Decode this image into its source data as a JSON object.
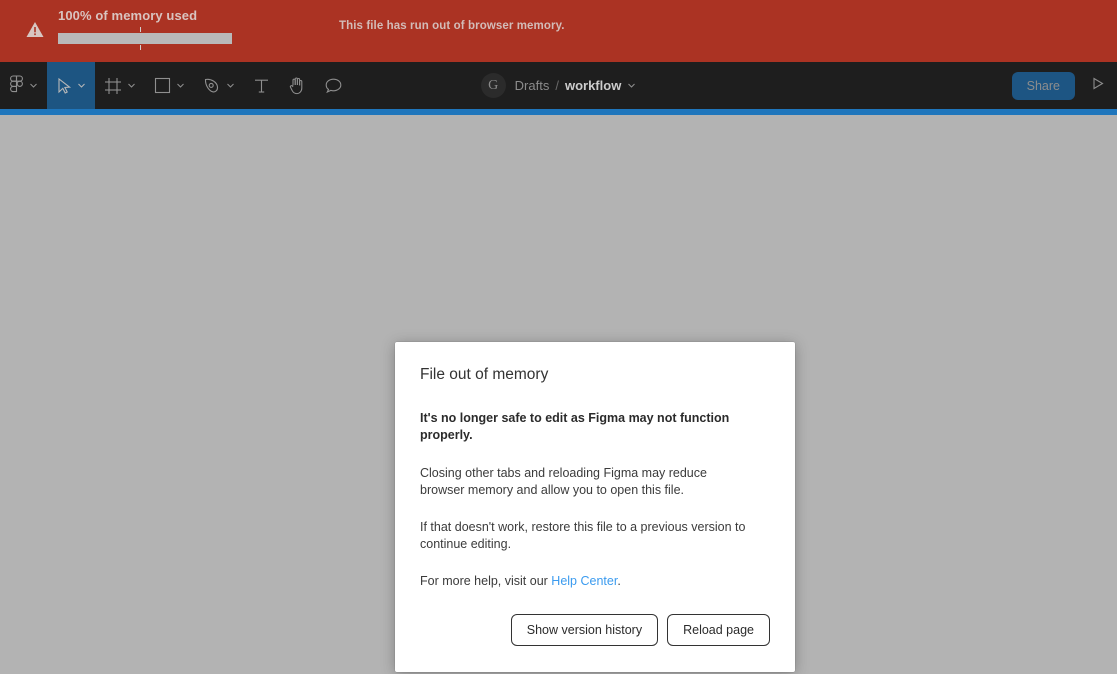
{
  "banner": {
    "warning_icon": "warning-triangle-icon",
    "title": "100% of memory used",
    "message": "This file has run out of browser memory.",
    "progress_percent": 100,
    "progress_marker_percent": 47,
    "background_color": "#ab3323",
    "progress_fill_color": "#b9b9b9"
  },
  "toolbar": {
    "background_color": "#1e1e1e",
    "selected_tool_color": "#1d5582",
    "tools": [
      {
        "name": "figma-menu",
        "icon": "figma-logo-icon",
        "has_chevron": true,
        "selected": false
      },
      {
        "name": "move-tool",
        "icon": "cursor-arrow-icon",
        "has_chevron": true,
        "selected": true
      },
      {
        "name": "frame-tool",
        "icon": "frame-icon",
        "has_chevron": true,
        "selected": false
      },
      {
        "name": "shape-tool",
        "icon": "rectangle-icon",
        "has_chevron": true,
        "selected": false
      },
      {
        "name": "pen-tool",
        "icon": "pen-icon",
        "has_chevron": true,
        "selected": false
      },
      {
        "name": "text-tool",
        "icon": "text-icon",
        "has_chevron": false,
        "selected": false
      },
      {
        "name": "hand-tool",
        "icon": "hand-icon",
        "has_chevron": false,
        "selected": false
      },
      {
        "name": "comment-tool",
        "icon": "comment-bubble-icon",
        "has_chevron": false,
        "selected": false
      }
    ],
    "avatar_initial": "G",
    "breadcrumb": {
      "project": "Drafts",
      "separator": "/",
      "file": "workflow"
    },
    "share_label": "Share",
    "present_icon": "play-triangle-icon"
  },
  "loading_bar": {
    "color": "#1f76bc",
    "visible": true
  },
  "canvas": {
    "background_color": "#b3b3b3"
  },
  "dialog": {
    "title": "File out of memory",
    "lead": "It's no longer safe to edit as Figma may not function properly.",
    "paragraph_1": "Closing other tabs and reloading Figma may reduce browser memory and allow you to open this file.",
    "paragraph_2": "If that doesn't work, restore this file to a previous version to continue editing.",
    "help_prefix": "For more help, visit our ",
    "help_link_label": "Help Center",
    "help_suffix": ".",
    "link_color": "#3b9bef",
    "buttons": {
      "version_history": "Show version history",
      "reload": "Reload page"
    }
  }
}
